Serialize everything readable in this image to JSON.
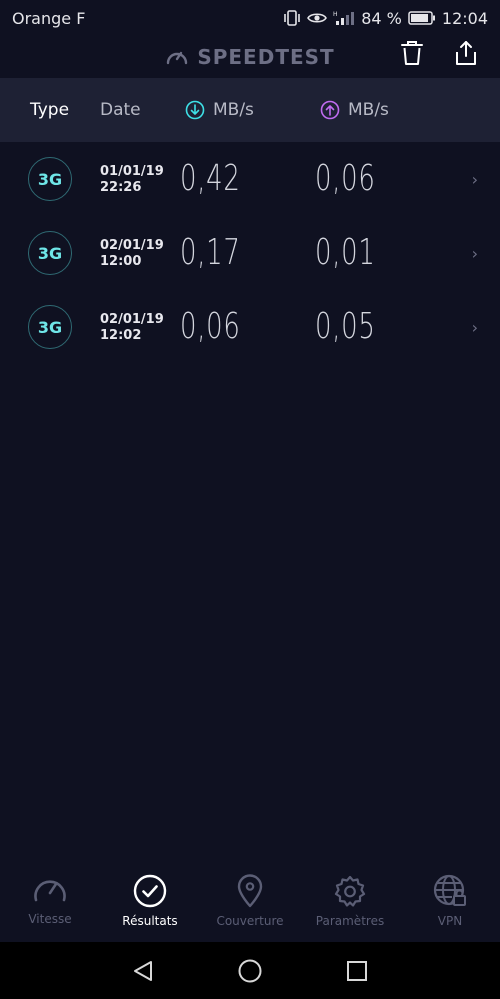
{
  "status_bar": {
    "carrier": "Orange F",
    "battery": "84 %",
    "time": "12:04"
  },
  "header": {
    "brand": "SPEEDTEST",
    "icons": [
      "speedometer-icon",
      "trash-icon",
      "share-icon"
    ]
  },
  "columns": {
    "type": "Type",
    "date": "Date",
    "download": "MB/s",
    "upload": "MB/s"
  },
  "results": [
    {
      "type": "3G",
      "date": "01/01/19",
      "time": "22:26",
      "download": "0,42",
      "upload": "0,06"
    },
    {
      "type": "3G",
      "date": "02/01/19",
      "time": "12:00",
      "download": "0,17",
      "upload": "0,01"
    },
    {
      "type": "3G",
      "date": "02/01/19",
      "time": "12:02",
      "download": "0,06",
      "upload": "0,05"
    }
  ],
  "bottom_nav": [
    {
      "label": "Vitesse",
      "icon": "speedometer-icon",
      "active": false
    },
    {
      "label": "Résultats",
      "icon": "check-circle-icon",
      "active": true
    },
    {
      "label": "Couverture",
      "icon": "location-pin-icon",
      "active": false
    },
    {
      "label": "Paramètres",
      "icon": "gear-icon",
      "active": false
    },
    {
      "label": "VPN",
      "icon": "globe-lock-icon",
      "active": false
    }
  ],
  "colors": {
    "background": "#0f1121",
    "header_band": "#1e2134",
    "download_accent": "#3ee0e6",
    "upload_accent": "#c06cf0",
    "badge_text": "#6fe6e8",
    "inactive": "#5b5e75"
  }
}
